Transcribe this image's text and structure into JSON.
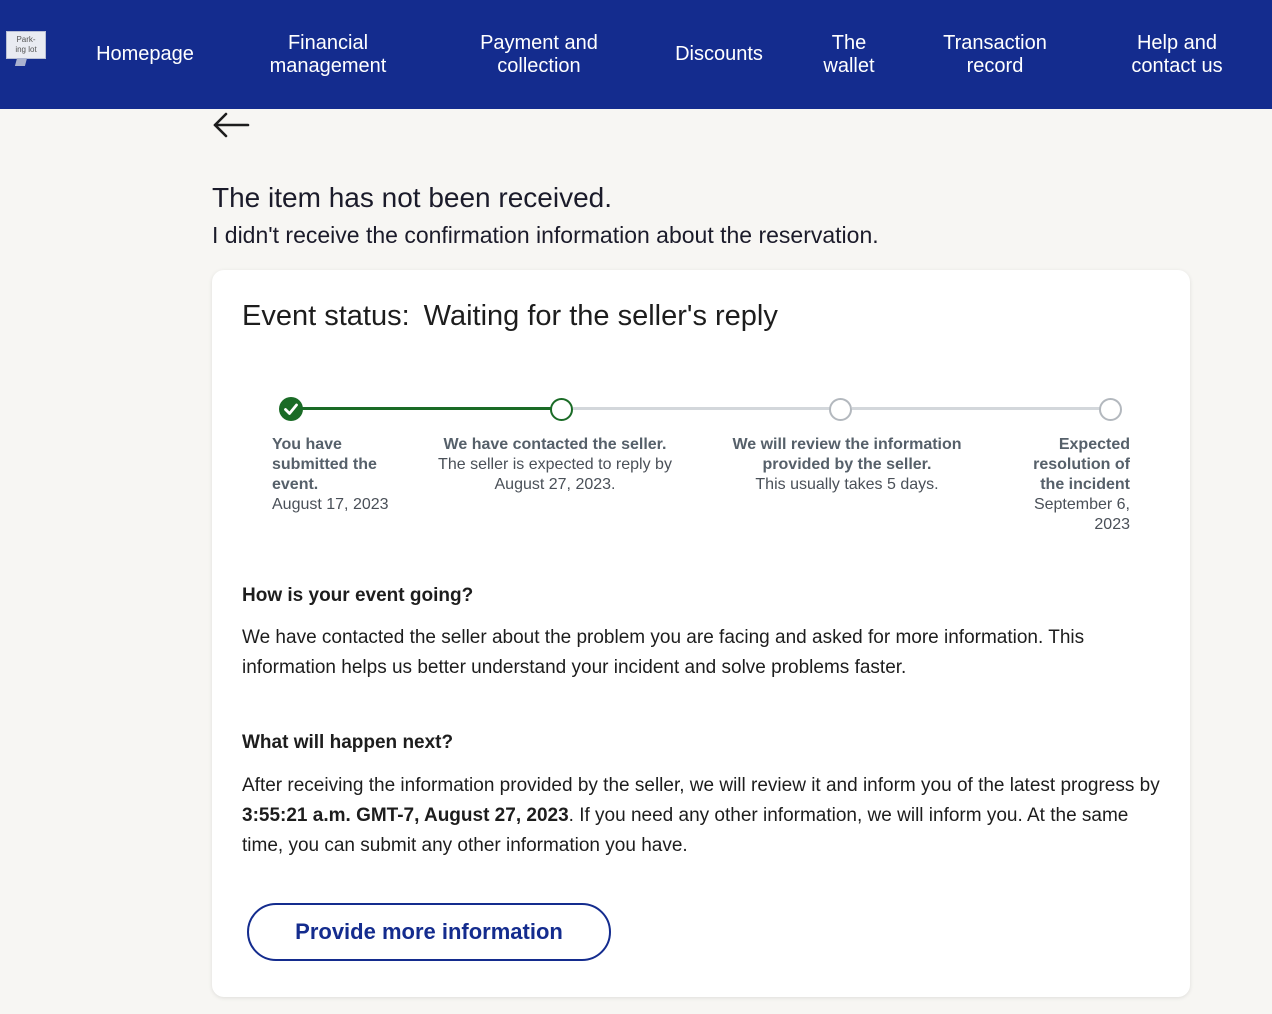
{
  "nav": {
    "logo_text": "Park-\ning lot",
    "items": [
      {
        "label": "Homepage"
      },
      {
        "label": "Financial\nmanagement"
      },
      {
        "label": "Payment and\ncollection"
      },
      {
        "label": "Discounts"
      },
      {
        "label": "The\nwallet"
      },
      {
        "label": "Transaction\nrecord"
      },
      {
        "label": "Help and\ncontact us"
      }
    ],
    "bg_color": "#142c8e"
  },
  "page": {
    "title": "The item has not been received.",
    "subtitle": "I didn't receive the confirmation information about the reservation."
  },
  "card": {
    "status_label": "Event status:",
    "status_value": "Waiting for the seller's reply",
    "steps": [
      {
        "title": "You have submitted the event.",
        "sub": "August 17, 2023",
        "state": "done"
      },
      {
        "title": "We have contacted the seller.",
        "sub": "The seller is expected to reply by August 27, 2023.",
        "state": "active"
      },
      {
        "title": "We will review the information provided by the seller.",
        "sub": "This usually takes 5 days.",
        "state": "pending"
      },
      {
        "title": "Expected resolution of the incident",
        "sub": "September 6, 2023",
        "state": "pending"
      }
    ],
    "section1": {
      "heading": "How is your event going?",
      "body": "We have contacted the seller about the problem you are facing and asked for more information. This information helps us better understand your incident and solve problems faster."
    },
    "section2": {
      "heading": "What will happen next?",
      "body_before": "After receiving the information provided by the seller, we will review it and inform you of the latest progress by ",
      "body_bold": "3:55:21 a.m. GMT-7, August 27, 2023",
      "body_after": ". If you need any other information, we will inform you. At the same time, you can submit any other information you have."
    },
    "button_label": "Provide more information"
  },
  "colors": {
    "accent": "#142c8e",
    "done_green": "#1a6b26",
    "pending_gray": "#b3b8be",
    "page_bg": "#f7f6f3"
  }
}
